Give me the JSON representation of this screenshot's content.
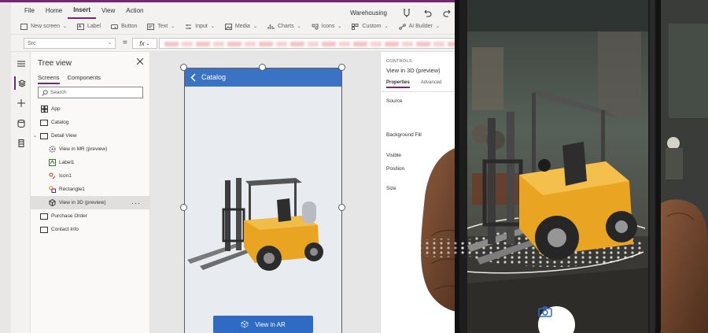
{
  "menubar": {
    "items": [
      {
        "label": "File",
        "active": false
      },
      {
        "label": "Home",
        "active": false
      },
      {
        "label": "Insert",
        "active": true
      },
      {
        "label": "View",
        "active": false
      },
      {
        "label": "Action",
        "active": false
      }
    ],
    "app_name": "Warehousing"
  },
  "ribbon": {
    "items": [
      {
        "label": "New screen",
        "icon": "new-screen-icon",
        "dropdown": true
      },
      {
        "label": "Label",
        "icon": "label-icon",
        "dropdown": false
      },
      {
        "label": "Button",
        "icon": "button-icon",
        "dropdown": false
      },
      {
        "label": "Text",
        "icon": "text-icon",
        "dropdown": true
      },
      {
        "label": "Input",
        "icon": "input-icon",
        "dropdown": true
      },
      {
        "label": "Media",
        "icon": "media-icon",
        "dropdown": true
      },
      {
        "label": "Charts",
        "icon": "charts-icon",
        "dropdown": true
      },
      {
        "label": "Icons",
        "icon": "icons-icon",
        "dropdown": true
      },
      {
        "label": "Custom",
        "icon": "custom-icon",
        "dropdown": true
      },
      {
        "label": "AI Builder",
        "icon": "ai-builder-icon",
        "dropdown": true
      }
    ]
  },
  "formula": {
    "property": "Src",
    "equals": "=",
    "fx": "fx"
  },
  "tree": {
    "title": "Tree view",
    "tabs": [
      {
        "label": "Screens",
        "active": true
      },
      {
        "label": "Components",
        "active": false
      }
    ],
    "search_placeholder": "Search",
    "items": [
      {
        "label": "App",
        "icon": "app-icon",
        "level": 0,
        "caret": "",
        "selected": false
      },
      {
        "label": "Catalog",
        "icon": "screen-icon",
        "level": 0,
        "caret": "",
        "selected": false
      },
      {
        "label": "Detail View",
        "icon": "screen-icon",
        "level": 0,
        "caret": "⌄",
        "selected": false
      },
      {
        "label": "View in MR (preview)",
        "icon": "mixed-reality-icon",
        "level": 1,
        "caret": "",
        "selected": false
      },
      {
        "label": "Label1",
        "icon": "label-icon",
        "level": 1,
        "caret": "",
        "selected": false
      },
      {
        "label": "Icon1",
        "icon": "icon-control-icon",
        "level": 1,
        "caret": "",
        "selected": false
      },
      {
        "label": "Rectangle1",
        "icon": "rectangle-icon",
        "level": 1,
        "caret": "",
        "selected": false
      },
      {
        "label": "View in 3D (preview)",
        "icon": "3d-object-icon",
        "level": 1,
        "caret": "",
        "selected": true
      },
      {
        "label": "Purchase Order",
        "icon": "screen-icon",
        "level": 0,
        "caret": "",
        "selected": false
      },
      {
        "label": "Contact Info",
        "icon": "screen-icon",
        "level": 0,
        "caret": "",
        "selected": false
      }
    ],
    "more": "···"
  },
  "canvas": {
    "header_title": "Catalog",
    "ar_button_label": "View in AR"
  },
  "props": {
    "category": "CONTROLS",
    "control_name": "View in 3D (preview)",
    "tabs": [
      {
        "label": "Properties",
        "active": true
      },
      {
        "label": "Advanced",
        "active": false
      }
    ],
    "labels": [
      "Source",
      "Background Fill",
      "Visible",
      "Position",
      "Size"
    ]
  },
  "colors": {
    "accent": "#742774",
    "app_header": "#3a72c4",
    "ar_button": "#2f6bc4",
    "forklift_yellow": "#e9a521"
  }
}
